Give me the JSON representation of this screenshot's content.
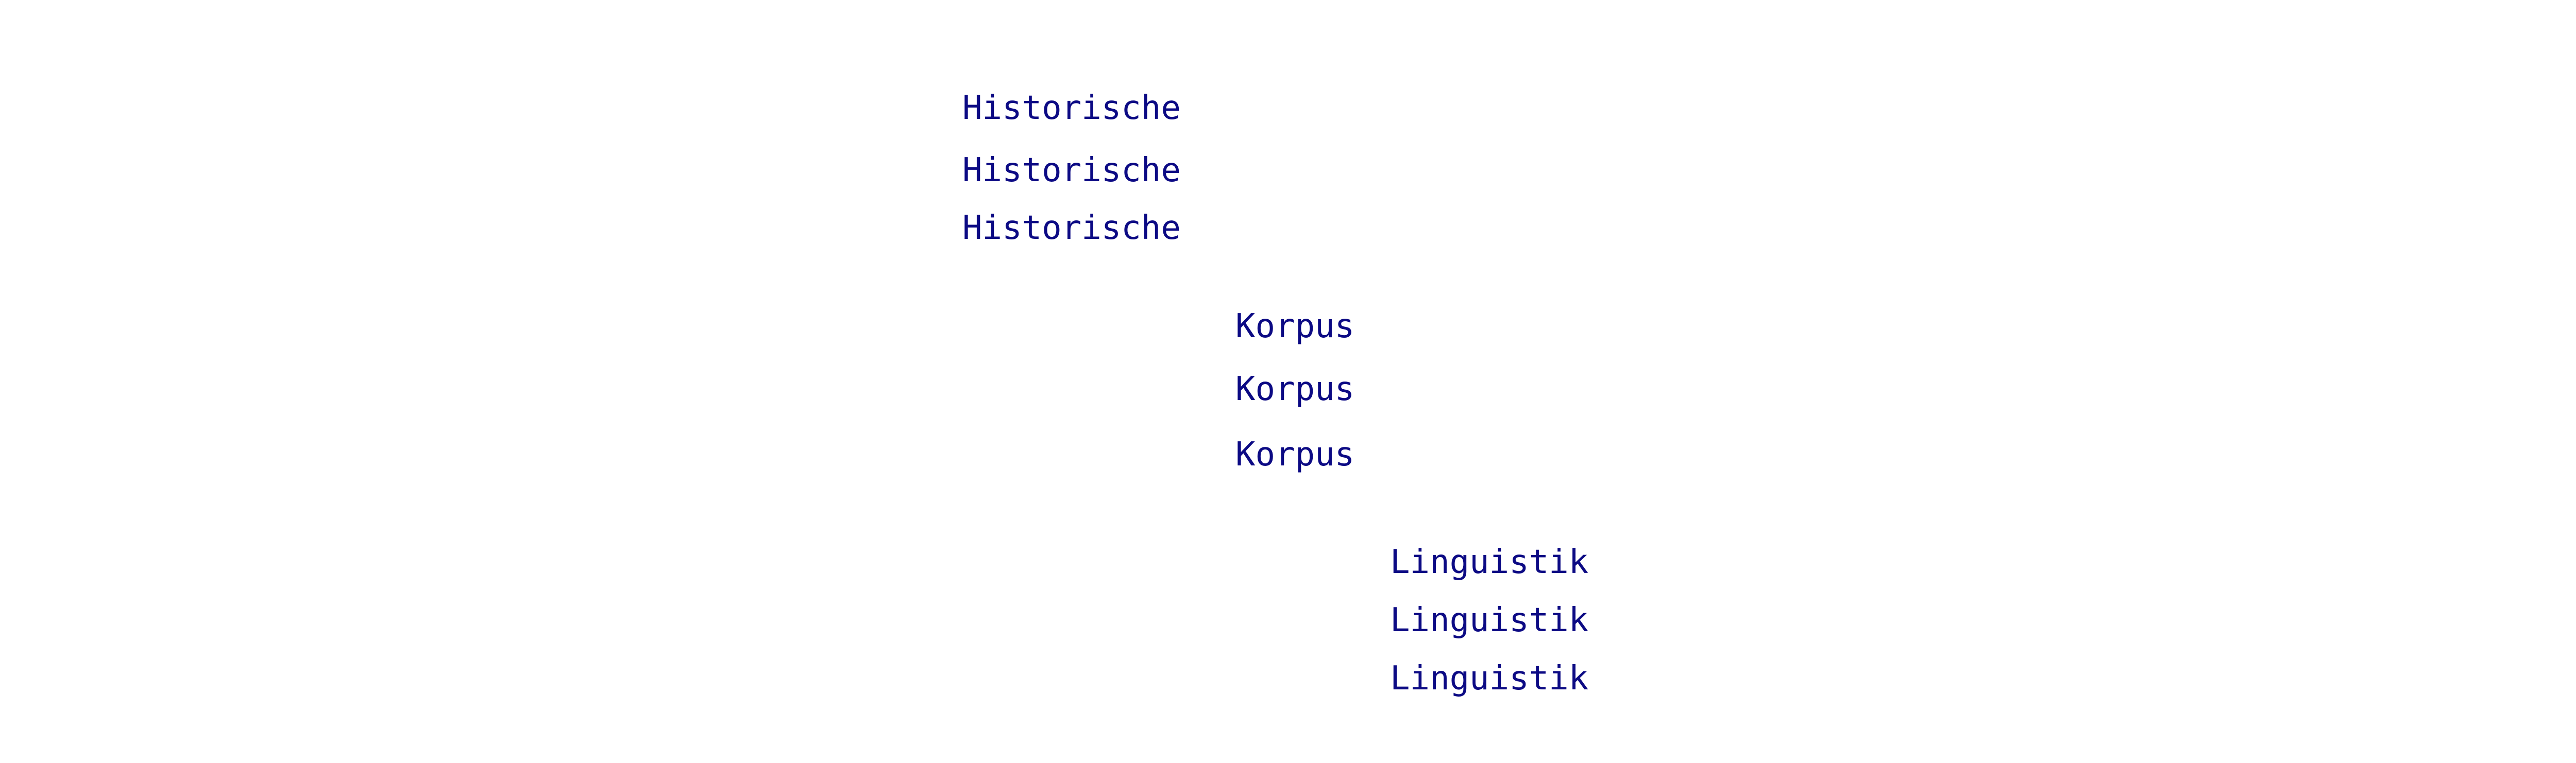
{
  "colors": {
    "text": "#0c0a84",
    "background": "#ffffff"
  },
  "words": {
    "historische": [
      "Historische",
      "Historische",
      "Historische"
    ],
    "korpus": [
      "Korpus",
      "Korpus",
      "Korpus"
    ],
    "linguistik": [
      "Linguistik",
      "Linguistik",
      "Linguistik"
    ]
  }
}
